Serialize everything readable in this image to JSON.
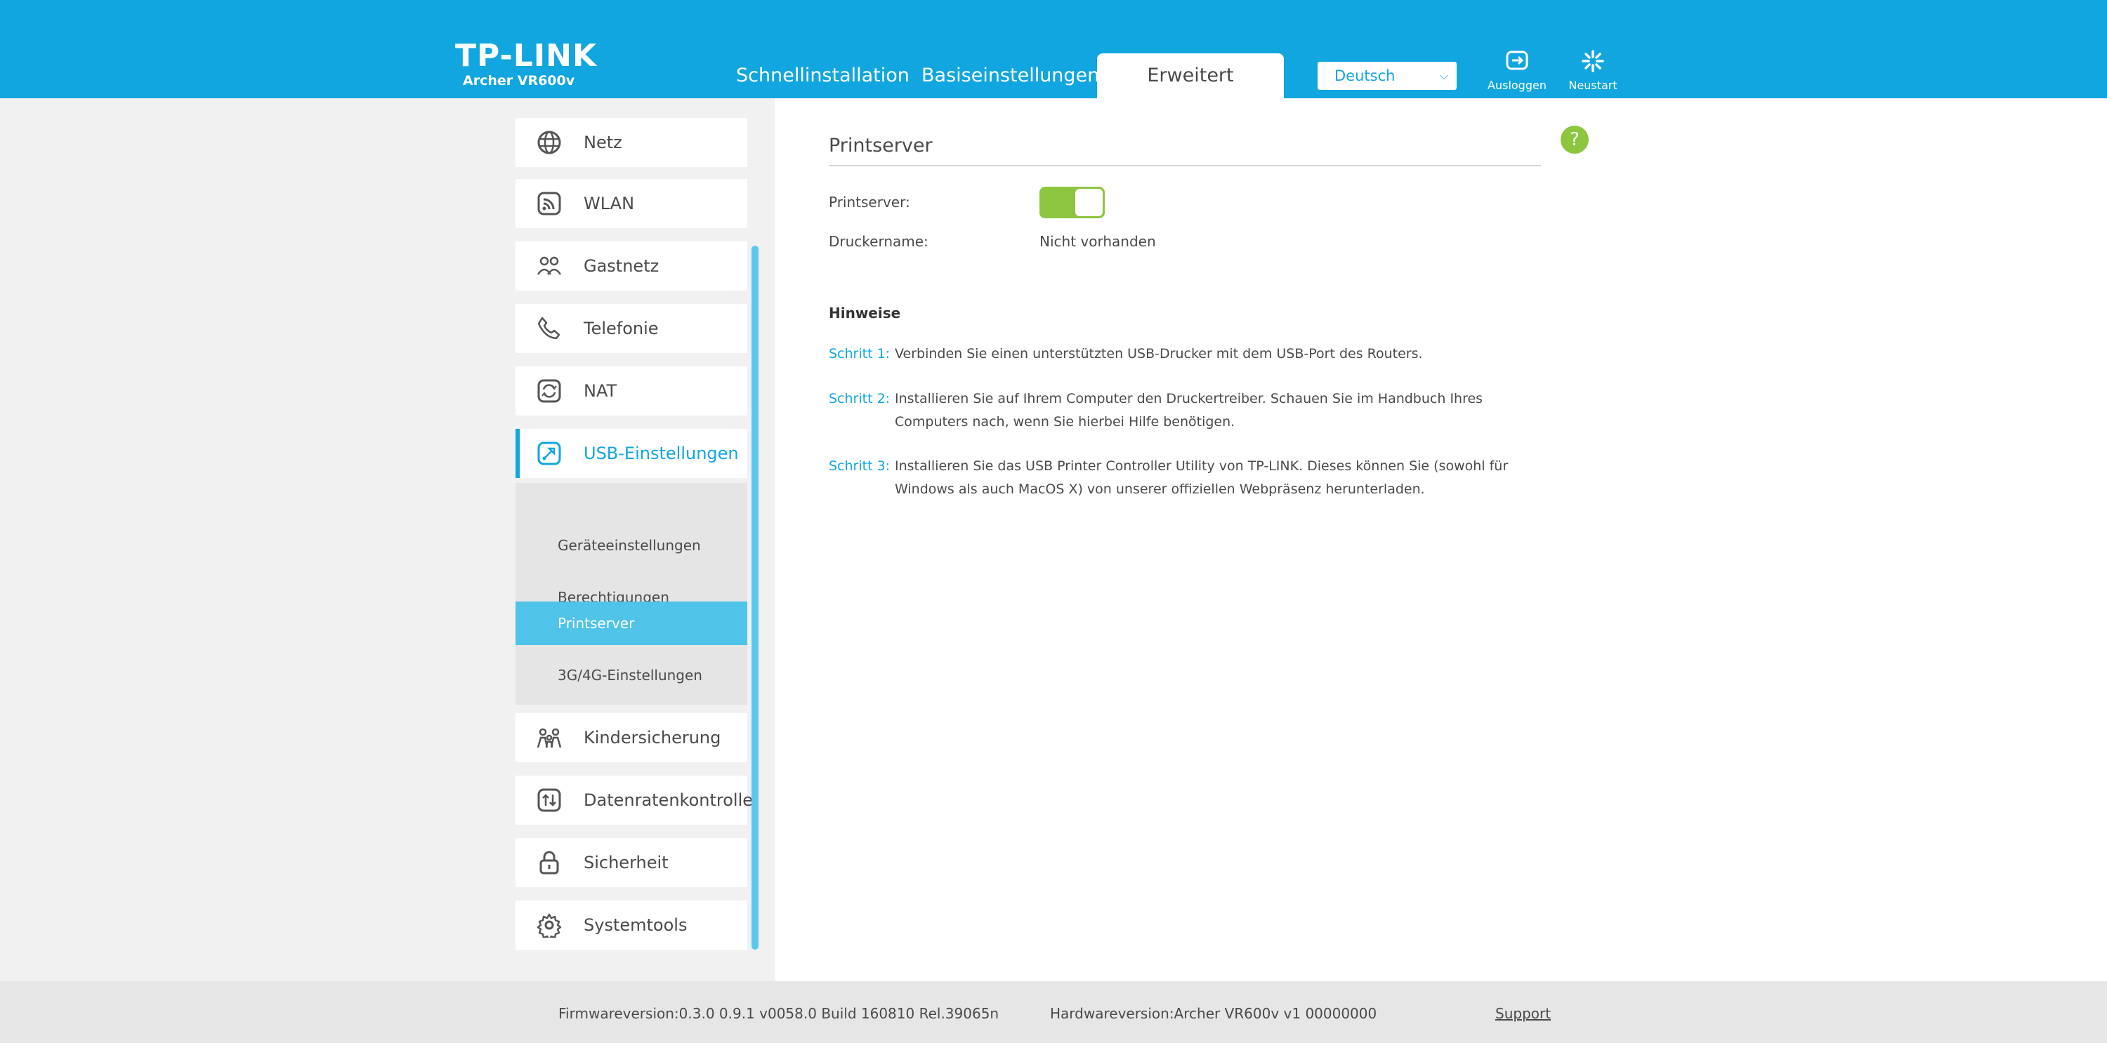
{
  "header": {
    "logo": "TP-LINK",
    "model": "Archer VR600v",
    "tabs": [
      {
        "label": "Schnellinstallation"
      },
      {
        "label": "Basiseinstellungen"
      },
      {
        "label": "Erweitert"
      }
    ],
    "language": "Deutsch",
    "logout_label": "Ausloggen",
    "reboot_label": "Neustart"
  },
  "sidebar": {
    "items": [
      {
        "label": "Netz",
        "icon": "globe-icon"
      },
      {
        "label": "WLAN",
        "icon": "wifi-icon"
      },
      {
        "label": "Gastnetz",
        "icon": "guest-network-icon"
      },
      {
        "label": "Telefonie",
        "icon": "phone-icon"
      },
      {
        "label": "NAT",
        "icon": "nat-icon"
      },
      {
        "label": "USB-Einstellungen",
        "icon": "usb-icon"
      },
      {
        "label": "Kindersicherung",
        "icon": "parental-control-icon"
      },
      {
        "label": "Datenratenkontrolle",
        "icon": "bandwidth-icon"
      },
      {
        "label": "Sicherheit",
        "icon": "lock-icon"
      },
      {
        "label": "Systemtools",
        "icon": "gear-icon"
      }
    ],
    "sub_items": [
      {
        "label": "Geräteeinstellungen"
      },
      {
        "label": "Berechtigungen"
      },
      {
        "label": "Printserver"
      },
      {
        "label": "3G/4G-Einstellungen"
      }
    ]
  },
  "main": {
    "title": "Printserver",
    "printserver_label": "Printserver:",
    "printserver_enabled": true,
    "printer_name_label": "Druckername:",
    "printer_name_value": "Nicht vorhanden",
    "notes_title": "Hinweise",
    "steps": [
      {
        "num": "Schritt 1:",
        "text": "Verbinden Sie einen unterstützten USB-Drucker mit dem USB-Port des Routers."
      },
      {
        "num": "Schritt 2:",
        "text": "Installieren Sie auf Ihrem Computer den Druckertreiber. Schauen Sie im Handbuch Ihres Computers nach, wenn Sie hierbei Hilfe benötigen."
      },
      {
        "num": "Schritt 3:",
        "text": "Installieren Sie das USB Printer Controller Utility von TP-LINK. Dieses können Sie (sowohl für Windows als auch MacOS X) von unserer offiziellen Webpräsenz herunterladen."
      }
    ]
  },
  "footer": {
    "firmware": "Firmwareversion:0.3.0 0.9.1 v0058.0 Build 160810 Rel.39065n",
    "hardware": "Hardwareversion:Archer VR600v v1 00000000",
    "support": "Support"
  },
  "colors": {
    "brand": "#11a6df",
    "accent_green": "#8cc63f",
    "submenu_active": "#4fc3e8"
  }
}
